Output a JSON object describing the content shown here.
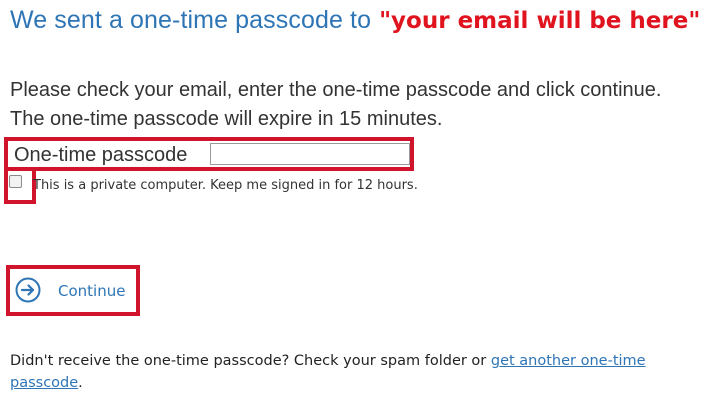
{
  "header": {
    "title": "We sent a one-time passcode to",
    "email_placeholder": "\"your email will be here\""
  },
  "instructions": {
    "line1": "Please check your email, enter the one-time passcode and click continue.",
    "line2": "The one-time passcode will expire in 15 minutes."
  },
  "passcode": {
    "label": "One-time passcode",
    "value": ""
  },
  "remember": {
    "label": "This is a private computer. Keep me signed in for 12 hours.",
    "checked": false
  },
  "continue": {
    "label": "Continue",
    "icon": "arrow-right-circle-icon"
  },
  "footer": {
    "text": "Didn't receive the one-time passcode? Check your spam folder or",
    "link_text": "get another one-time passcode",
    "trailing": "."
  },
  "colors": {
    "title_blue": "#2e75b6",
    "highlight_red": "#d0142b",
    "email_red": "#e0141e",
    "link_blue": "#2e75b6"
  }
}
